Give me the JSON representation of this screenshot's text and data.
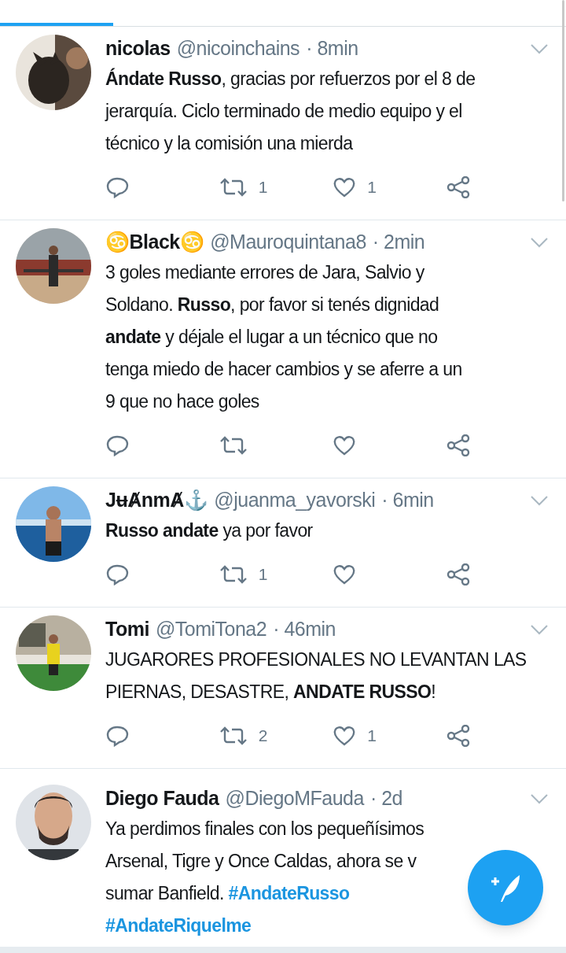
{
  "tabs": [
    {
      "selected": true
    },
    {
      "selected": false
    },
    {
      "selected": false
    },
    {
      "selected": false
    },
    {
      "selected": false
    }
  ],
  "tweets": [
    {
      "name": "nicolas",
      "handle": "@nicoinchains",
      "time": "· 8min",
      "lines": [
        [
          {
            "kind": "bold",
            "text": "Ándate Russo"
          },
          {
            "kind": "plain",
            "text": ", gracias por refuerzos por el 8 de"
          }
        ],
        [
          {
            "kind": "plain",
            "text": "jerarquía. Ciclo terminado de medio equipo y el"
          }
        ],
        [
          {
            "kind": "plain",
            "text": "técnico y la comisión una mierda"
          }
        ]
      ],
      "retweets": "1",
      "likes": "1"
    },
    {
      "name": "♋Black♋",
      "handle": "@Mauroquintana8",
      "time": "· 2min",
      "lines": [
        [
          {
            "kind": "plain",
            "text": "3 goles mediante errores de Jara, Salvio y"
          }
        ],
        [
          {
            "kind": "plain",
            "text": "Soldano. "
          },
          {
            "kind": "bold",
            "text": "Russo"
          },
          {
            "kind": "plain",
            "text": ", por favor si tenés dignidad"
          }
        ],
        [
          {
            "kind": "bold",
            "text": "andate"
          },
          {
            "kind": "plain",
            "text": " y déjale el lugar a un técnico que no"
          }
        ],
        [
          {
            "kind": "plain",
            "text": "tenga miedo de hacer cambios y se aferre a un"
          }
        ],
        [
          {
            "kind": "plain",
            "text": "9 que no hace goles"
          }
        ]
      ]
    },
    {
      "name": "JʉȺnmȺ⚓",
      "handle": "@juanma_yavorski",
      "time": "· 6min",
      "lines": [
        [
          {
            "kind": "bold",
            "text": "Russo andate"
          },
          {
            "kind": "plain",
            "text": " ya por favor"
          }
        ]
      ],
      "retweets": "1"
    },
    {
      "name": "Tomi",
      "handle": "@TomiTona2",
      "time": "· 46min",
      "lines": [
        [
          {
            "kind": "plain",
            "text": "JUGARORES PROFESIONALES NO LEVANTAN LAS"
          }
        ],
        [
          {
            "kind": "plain",
            "text": "PIERNAS, DESASTRE, "
          },
          {
            "kind": "bold",
            "text": "ANDATE RUSSO"
          },
          {
            "kind": "plain",
            "text": "!"
          }
        ]
      ],
      "retweets": "2",
      "likes": "1"
    },
    {
      "name": "Diego Fauda",
      "handle": "@DiegoMFauda",
      "time": "· 2d",
      "lines": [
        [
          {
            "kind": "plain",
            "text": "Ya perdimos finales con los pequeñísimos"
          }
        ],
        [
          {
            "kind": "plain",
            "text": "Arsenal, Tigre y Once Caldas, ahora se v"
          }
        ],
        [
          {
            "kind": "plain",
            "text": "sumar Banfield. "
          },
          {
            "kind": "hashtag",
            "text": "#AndateRusso"
          }
        ],
        [
          {
            "kind": "hashtag",
            "text": "#AndateRiquelme"
          }
        ]
      ]
    }
  ]
}
